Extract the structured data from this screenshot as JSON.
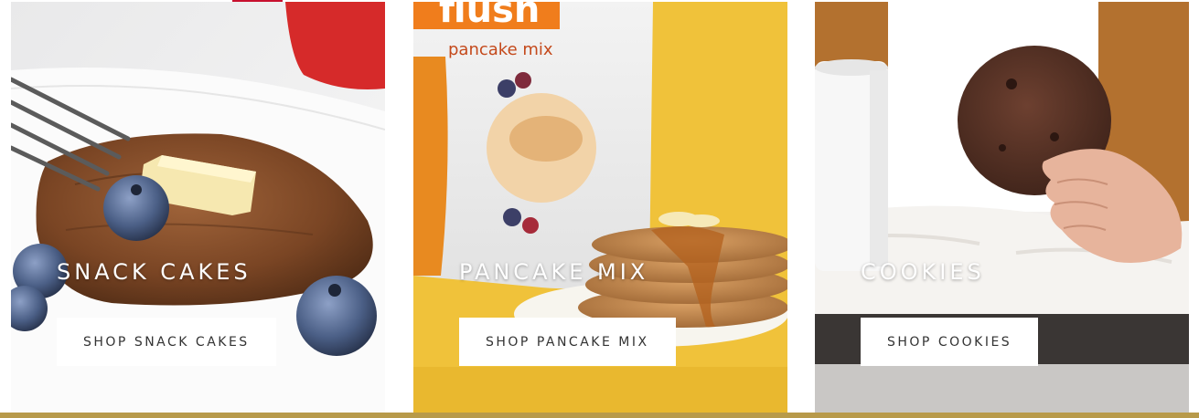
{
  "categories": [
    {
      "title": "SNACK CAKES",
      "button": "SHOP SNACK CAKES",
      "image_alt": "snack-cake-with-blueberries"
    },
    {
      "title": "PANCAKE MIX",
      "button": "SHOP PANCAKE MIX",
      "image_alt": "pancake-mix-bag-and-pancake-stack",
      "package_text": {
        "brand": "flush",
        "product": "pancake mix"
      }
    },
    {
      "title": "COOKIES",
      "button": "SHOP COOKIES",
      "image_alt": "chocolate-cookie-held-in-hand"
    }
  ],
  "colors": {
    "accent_red": "#c8102e",
    "tile2_background": "#f0c23a",
    "button_bg": "#ffffff",
    "title_text": "#ffffff"
  }
}
